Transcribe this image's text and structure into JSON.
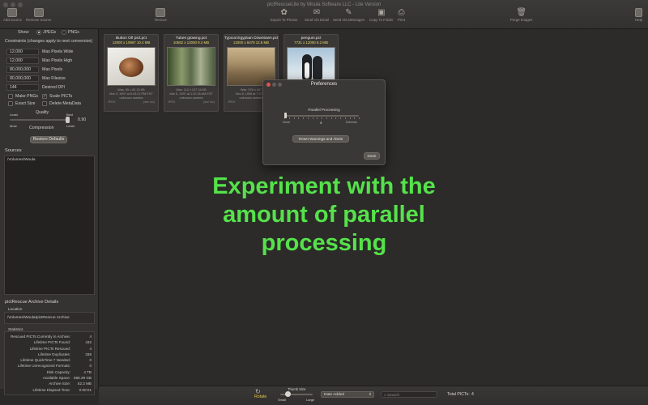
{
  "window": {
    "title": "pictRescueLite by Woula Software LLC - Lite Version"
  },
  "toolbar": {
    "items": [
      {
        "label": "Add Source"
      },
      {
        "label": "Remove Source"
      },
      {
        "label": "Rescue"
      },
      {
        "label": "Export To Photos"
      },
      {
        "label": "Send Via Email"
      },
      {
        "label": "Send Via Messages"
      },
      {
        "label": "Copy To Folder"
      },
      {
        "label": "Print"
      },
      {
        "label": "Purge Images"
      },
      {
        "label": "Help"
      }
    ]
  },
  "sidebar": {
    "show_label": "Show:",
    "show_jpegs": "JPEGs",
    "show_pngs": "PNGs",
    "constraints_title": "Constraints (changes apply to next conversion)",
    "fields": [
      {
        "value": "12,000",
        "label": "Max Pixels Wide"
      },
      {
        "value": "12,000",
        "label": "Max Pixels High"
      },
      {
        "value": "80,000,000",
        "label": "Max Pixels"
      },
      {
        "value": "80,000,000",
        "label": "Max Filesize"
      },
      {
        "value": "144",
        "label": "Desired DPI"
      }
    ],
    "checks": {
      "make_pngs": "Make PNGs",
      "scale_picts": "Scale PICTs",
      "exact_size": "Exact Size",
      "delete_metadata": "Delete MetaData"
    },
    "quality": {
      "title": "Quality",
      "least": "Least",
      "best": "Best",
      "most": "Most",
      "least2": "Least",
      "compression": "Compression",
      "value": "0.90"
    },
    "restore_defaults": "Restore Defaults",
    "sources_title": "Sources",
    "sources": [
      "/Volumes/Woula"
    ],
    "archive_title": "pictRescue Archive Details",
    "location_label": "Location",
    "location_value": "/Volumes/Woula/pictRescue Archive",
    "statistics_label": "Statistics",
    "stats": [
      {
        "k": "Rescued PICTs Currently in Archive:",
        "v": "4"
      },
      {
        "k": "Lifetime PICTs Found:",
        "v": "432"
      },
      {
        "k": "Lifetime PICTs Rescued:",
        "v": "4"
      },
      {
        "k": "Lifetime Duplicates:",
        "v": "336"
      },
      {
        "k": "Lifetime QuickTime 7 Needed:",
        "v": "0"
      },
      {
        "k": "Lifetime Unrecognized Formats:",
        "v": "0"
      },
      {
        "k": "Disk Capacity:",
        "v": "4 TB"
      },
      {
        "k": "Available Space:",
        "v": "868.29 GB"
      },
      {
        "k": "Archive Size:",
        "v": "52.3 MB"
      },
      {
        "k": "Lifetime Elapsed Time:",
        "v": "0:00:01"
      }
    ]
  },
  "thumbnails": [
    {
      "name": "Button Off pict.pct",
      "dims": "12000 x 10967  10.4 MB",
      "meta1": "Was:   95 x 83   15 KB",
      "meta2": "Mar 3, 1997 at 6:43:21 PM EST",
      "meta3": "unknown camera",
      "tag": "JPEG",
      "link": "(see src)"
    },
    {
      "name": "Tubes glowing.pct",
      "dims": "10582 x 12000   9.2 MB",
      "meta1": "Was:  112 x 127   24 KB",
      "meta2": "Mar 5, 1997 at 1:32:18 AM EST",
      "meta3": "unknown camera",
      "tag": "JPEG",
      "link": "(see src)"
    },
    {
      "name": "Typical Egyptian Downtown.pct",
      "dims": "12000 x 8479  12.8 MB",
      "meta1": "Was:   576 x 407",
      "meta2": "Dec 8, 1996 at 7:07:17",
      "meta3": "unknown camera",
      "tag": "JPEG",
      "link": ""
    },
    {
      "name": "penguin.pct",
      "dims": "7731 x 12000  8.2 MB",
      "meta1": "",
      "meta2": "",
      "meta3": "",
      "tag": "",
      "link": ""
    }
  ],
  "dialog": {
    "title": "Preferences",
    "slider_label": "Parallel Processing",
    "min_label": "None",
    "max_label": "Extreme",
    "value": "4",
    "slider_fraction": 0.0,
    "reset_button": "Reset Warnings and Alerts",
    "done_button": "Done"
  },
  "caption": {
    "line1": "Experiment with the",
    "line2": "amount of parallel",
    "line3": "processing"
  },
  "bottombar": {
    "rotate": "Rotate",
    "thumb_size": "Thumb Size",
    "small": "Small",
    "large": "Large",
    "sort_value": "Date Added",
    "search_placeholder": "Search",
    "total_label": "Total PICTs:",
    "total_value": "4"
  },
  "colors": {
    "accent_caption": "#55e24a",
    "dims_yellow": "#e9d96b"
  }
}
